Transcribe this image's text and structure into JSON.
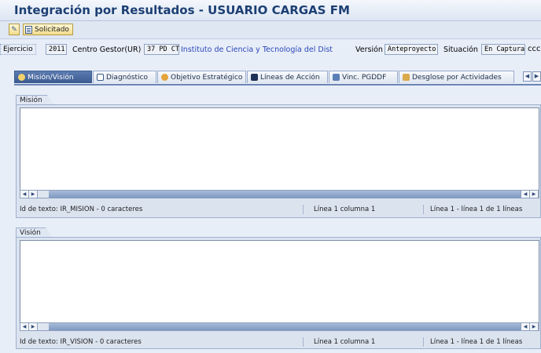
{
  "window": {
    "title": "Integración por Resultados - USUARIO CARGAS FM"
  },
  "toolbar": {
    "solicitado_label": "Solicitado"
  },
  "header": {
    "ejercicio_label": "Ejercicio",
    "ejercicio_value": "2011",
    "centro_label": "Centro Gestor(UR)",
    "centro_code": "37 PD CT",
    "centro_name": "Instituto de Ciencia y Tecnología del Dist",
    "version_label": "Versión",
    "version_value": "Anteproyecto",
    "situacion_label": "Situación",
    "situacion_value": "En Captura",
    "situacion_extra": "ccc"
  },
  "tabs": [
    {
      "label": "Misión/Visión",
      "icon": "gear-icon"
    },
    {
      "label": "Diagnóstico",
      "icon": "chart-icon"
    },
    {
      "label": "Objetivo Estratégico",
      "icon": "target-icon"
    },
    {
      "label": "Líneas de Acción",
      "icon": "grid-icon"
    },
    {
      "label": "Vinc. PGDDF",
      "icon": "link-icon"
    },
    {
      "label": "Desglose por Actividades",
      "icon": "tools-icon"
    }
  ],
  "mision": {
    "label": "Misión",
    "status_id": "Id de texto: IR_MISION - 0 caracteres",
    "status_pos": "Línea 1 columna 1",
    "status_lines": "Línea 1 - línea 1 de 1 líneas"
  },
  "vision": {
    "label": "Visión",
    "status_id": "Id de texto: IR_VISION - 0 caracteres",
    "status_pos": "Línea 1 columna 1",
    "status_lines": "Línea 1 - línea 1 de 1 líneas"
  },
  "colors": {
    "accent": "#1c3f73",
    "active_tab": "#3a5a90",
    "link": "#2a47b8"
  }
}
